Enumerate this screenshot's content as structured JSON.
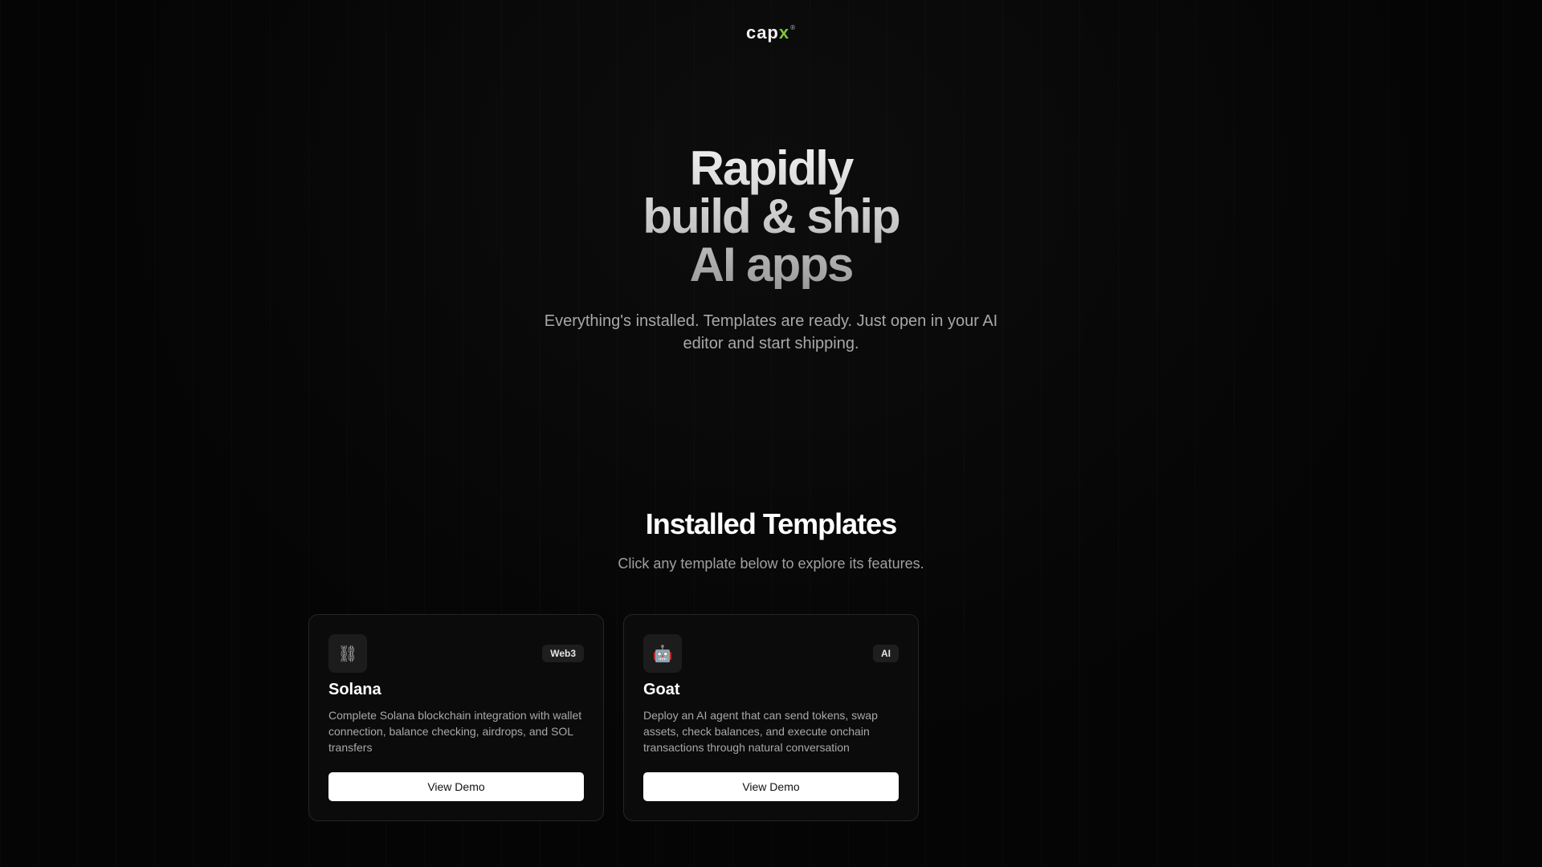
{
  "logo": {
    "text_main": "cap",
    "text_accent": "x",
    "mark": "®"
  },
  "hero": {
    "title_lines": [
      "Rapidly",
      "build & ship",
      "AI apps"
    ],
    "subtitle": "Everything's installed. Templates are ready. Just open in your AI editor and start shipping."
  },
  "templates_section": {
    "title": "Installed Templates",
    "subtitle": "Click any template below to explore its features."
  },
  "templates": [
    {
      "icon": "chain-link-icon",
      "icon_glyph": "⛓",
      "badge": "Web3",
      "title": "Solana",
      "description": "Complete Solana blockchain integration with wallet connection, balance checking, airdrops, and SOL transfers",
      "button_label": "View Demo"
    },
    {
      "icon": "robot-icon",
      "icon_glyph": "🤖",
      "badge": "AI",
      "title": "Goat",
      "description": "Deploy an AI agent that can send tokens, swap assets, check balances, and execute onchain transactions through natural conversation",
      "button_label": "View Demo"
    }
  ],
  "colors": {
    "accent": "#7cc63d",
    "background": "#050505",
    "card_bg": "#0b0b0b"
  }
}
